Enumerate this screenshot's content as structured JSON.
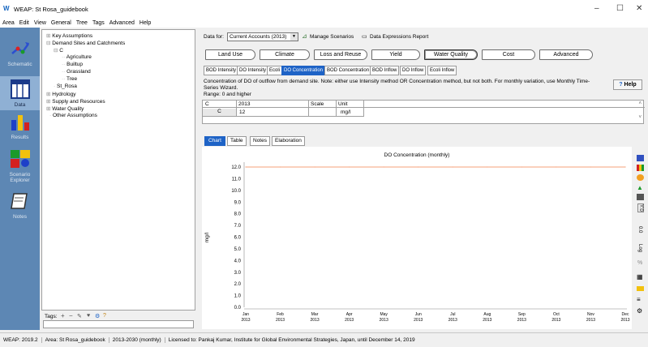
{
  "window": {
    "title": "WEAP: St Rosa_guidebook",
    "minimize": "–",
    "maximize": "☐",
    "close": "✕"
  },
  "menu": [
    "Area",
    "Edit",
    "View",
    "General",
    "Tree",
    "Tags",
    "Advanced",
    "Help"
  ],
  "leftbar": {
    "items": [
      "Schematic",
      "Data",
      "Results",
      "Scenario Explorer",
      "Notes"
    ]
  },
  "tree": {
    "nodes": [
      "Key Assumptions",
      "Demand Sites and Catchments",
      "C",
      "Agriculture",
      "Builtup",
      "Grassland",
      "Tree",
      "St_Rosa",
      "Hydrology",
      "Supply and Resources",
      "Water Quality",
      "Other Assumptions"
    ],
    "tags_label": "Tags:"
  },
  "data_for": {
    "label": "Data for:",
    "value": "Current Accounts (2013)",
    "manage": "Manage Scenarios",
    "expressions": "Data Expressions Report"
  },
  "main_tabs": [
    "Land Use",
    "Climate",
    "Loss and Reuse",
    "Yield",
    "Water Quality",
    "Cost",
    "Advanced"
  ],
  "sub_tabs": [
    "BOD Intensity",
    "DO Intensity",
    "Ecoli",
    "DO Concentration",
    "BOD Concentration",
    "BOD Inflow",
    "DO Inflow",
    "Ecoli Inflow"
  ],
  "description": {
    "text": "Concentration of DO of outflow from demand site.  Note: either use Intensity method OR Concentration method, but not both.  For monthly variation, use Monthly Time-Series Wizard.",
    "range": "Range: 0 and higher",
    "help": "Help"
  },
  "grid": {
    "headers": [
      "C",
      "2013",
      "Scale",
      "Unit"
    ],
    "row": [
      "C",
      "12",
      "",
      "mg/l"
    ]
  },
  "chart_tabs": [
    "Chart",
    "Table",
    "Notes",
    "Elaboration"
  ],
  "chart_data": {
    "type": "line",
    "title": "DO Concentration (monthly)",
    "ylabel": "mg/l",
    "ylim": [
      0,
      12
    ],
    "yticks": [
      "0.0",
      "1.0",
      "2.0",
      "3.0",
      "4.0",
      "5.0",
      "6.0",
      "7.0",
      "8.0",
      "9.0",
      "10.0",
      "11.0",
      "12.0"
    ],
    "categories": [
      "Jan 2013",
      "Feb 2013",
      "Mar 2013",
      "Apr 2013",
      "May 2013",
      "Jun 2013",
      "Jul 2013",
      "Aug 2013",
      "Sep 2013",
      "Oct 2013",
      "Nov 2013",
      "Dec 2013"
    ],
    "category_labels": [
      [
        "Jan",
        "2013"
      ],
      [
        "Feb",
        "2013"
      ],
      [
        "Mar",
        "2013"
      ],
      [
        "Apr",
        "2013"
      ],
      [
        "May",
        "2013"
      ],
      [
        "Jun",
        "2013"
      ],
      [
        "Jul",
        "2013"
      ],
      [
        "Aug",
        "2013"
      ],
      [
        "Sep",
        "2013"
      ],
      [
        "Oct",
        "2013"
      ],
      [
        "Nov",
        "2013"
      ],
      [
        "Dec",
        "2013"
      ]
    ],
    "series": [
      {
        "values": [
          12,
          12,
          12,
          12,
          12,
          12,
          12,
          12,
          12,
          12,
          12,
          12
        ],
        "color": "#f4a07a"
      }
    ],
    "grid": false
  },
  "chart_toolbar": {
    "labels": [
      "Y:0",
      "0.0",
      "Log"
    ]
  },
  "status": {
    "version": "WEAP: 2019.2",
    "area": "Area: St Rosa_guidebook",
    "period": "2013-2030 (monthly)",
    "license": "Licensed to: Pankaj Kumar, Institute for Global Environmental Strategies, Japan, until December 14, 2019"
  },
  "colors": {
    "accent": "#1e63c6",
    "sidebar": "#5d87b4",
    "series": "#f4a07a"
  }
}
